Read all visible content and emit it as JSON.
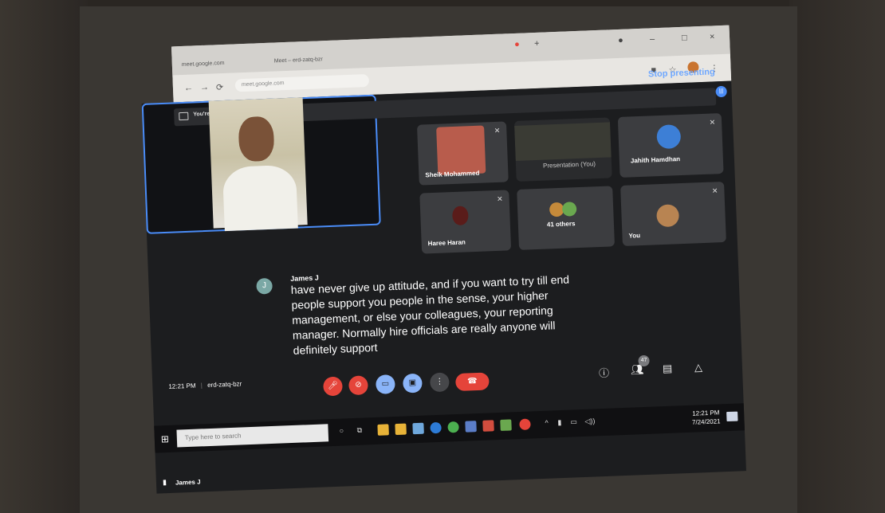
{
  "browser": {
    "tabs": [
      "meet.google.com",
      "Meet – erd-zatq-bzr"
    ],
    "address": "meet.google.com"
  },
  "meet": {
    "stop_presenting": "Stop presenting",
    "presenting_label": "You're presenting to everyone",
    "main_speaker": "James J",
    "participants": [
      {
        "name": "Sheik Mohammed"
      },
      {
        "name": "Presentation (You)"
      },
      {
        "name": "Jahith Hamdhan"
      },
      {
        "name": "Haree Haran"
      },
      {
        "name": "41 others"
      },
      {
        "name": "You"
      }
    ],
    "caption": {
      "initial": "J",
      "speaker": "James J",
      "text": "have never give up attitude, and if you want to try till end people support you people in the sense, your higher management, or else your colleagues, your reporting manager. Normally hire officials are really anyone will definitely support"
    },
    "time": "12:21 PM",
    "separator": "|",
    "meeting_code": "erd-zatq-bzr",
    "people_count": "47"
  },
  "taskbar": {
    "search_placeholder": "Type here to search",
    "clock_time": "12:21 PM",
    "clock_date": "7/24/2021"
  },
  "colors": {
    "accent": "#4a8cf7",
    "end_call": "#e5443a",
    "meet_bg": "#1c1d1f",
    "tile_bg": "#3c3d40"
  }
}
